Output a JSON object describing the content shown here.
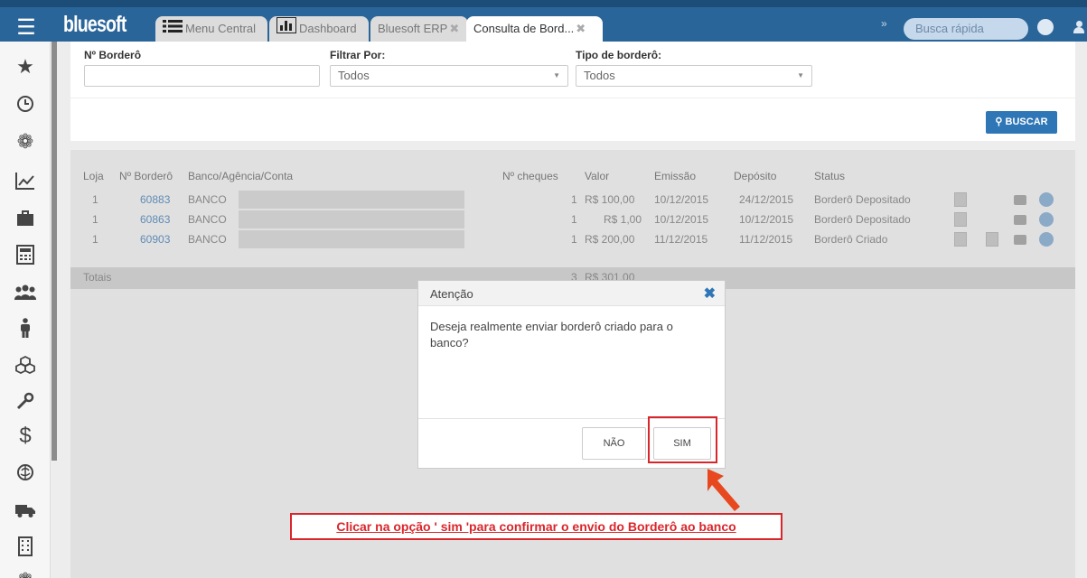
{
  "app": {
    "logo": "bluesoft"
  },
  "tabs": [
    {
      "label": "Menu Central",
      "icon": "list-icon"
    },
    {
      "label": "Dashboard",
      "icon": "bar-chart-icon"
    },
    {
      "label": "Bluesoft ERP",
      "icon": ""
    },
    {
      "label": "Consulta de Bord...",
      "icon": ""
    }
  ],
  "search": {
    "placeholder": "Busca rápida"
  },
  "sidebar": {
    "items": [
      "star-icon",
      "clock-icon",
      "gear-icon",
      "trend-chart-icon",
      "briefcase-icon",
      "calculator-icon",
      "users-icon",
      "person-icon",
      "boxes-icon",
      "wrench-icon",
      "dollar-icon",
      "brain-icon",
      "truck-icon",
      "building-icon"
    ]
  },
  "filters": {
    "bordero_label": "Nº Borderô",
    "filtrar_label": "Filtrar Por:",
    "filtrar_value": "Todos",
    "tipo_label": "Tipo de borderô:",
    "tipo_value": "Todos",
    "buscar_label": "BUSCAR"
  },
  "table": {
    "headers": [
      "Loja",
      "Nº Borderô",
      "Banco/Agência/Conta",
      "Nº cheques",
      "Valor",
      "Emissão",
      "Depósito",
      "Status"
    ],
    "rows": [
      {
        "loja": "1",
        "bordero": "60883",
        "banco": "BANCO",
        "cheques": "1",
        "valor": "R$ 100,00",
        "emissao": "10/12/2015",
        "deposito": "24/12/2015",
        "status": "Borderô Depositado"
      },
      {
        "loja": "1",
        "bordero": "60863",
        "banco": "BANCO",
        "cheques": "1",
        "valor": "R$ 1,00",
        "emissao": "10/12/2015",
        "deposito": "10/12/2015",
        "status": "Borderô Depositado"
      },
      {
        "loja": "1",
        "bordero": "60903",
        "banco": "BANCO",
        "cheques": "1",
        "valor": "R$ 200,00",
        "emissao": "11/12/2015",
        "deposito": "11/12/2015",
        "status": "Borderô Criado"
      }
    ],
    "totals": {
      "label": "Totais",
      "cheques": "3",
      "valor": "R$ 301,00"
    }
  },
  "modal": {
    "title": "Atenção",
    "message": "Deseja realmente enviar borderô criado para o banco?",
    "no_label": "NÃO",
    "yes_label": "SIM"
  },
  "annotation": {
    "text": "Clicar na opção ' sim 'para confirmar o envio do Borderô ao banco",
    "color": "#d9262b"
  }
}
